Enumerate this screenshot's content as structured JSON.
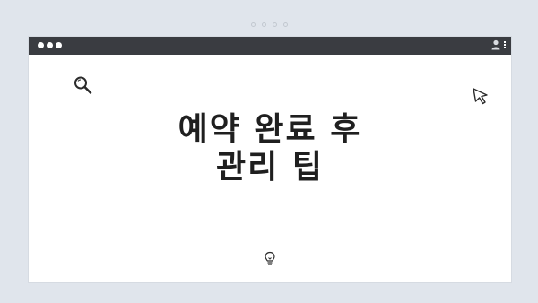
{
  "window": {
    "title_lines": [
      "예약 완료 후",
      "관리 팁"
    ]
  },
  "icons": {
    "search": "search-icon",
    "cursor": "cursor-arrow-icon",
    "bulb": "lightbulb-icon",
    "avatar": "user-icon",
    "menu": "kebab-menu-icon"
  },
  "colors": {
    "page_background": "#e0e5ec",
    "titlebar": "#3a3c41",
    "window_background": "#ffffff",
    "title_text": "#1f1f1f"
  }
}
